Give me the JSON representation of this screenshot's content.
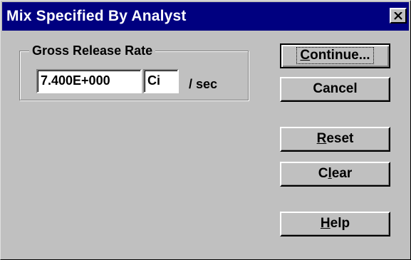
{
  "window": {
    "title": "Mix Specified By Analyst"
  },
  "group": {
    "legend": "Gross Release Rate",
    "rate_value": "7.400E+000",
    "unit_value": "Ci",
    "per_label": "/ sec"
  },
  "buttons": {
    "continue": {
      "first": "C",
      "rest": "ontinue..."
    },
    "cancel": {
      "label": "Cancel"
    },
    "reset": {
      "first": "R",
      "rest": "eset"
    },
    "clear": {
      "first": "C",
      "mnemonic": "l",
      "rest": "ear"
    },
    "help": {
      "first": "H",
      "rest": "elp"
    }
  },
  "icons": {
    "close": "close-icon"
  }
}
